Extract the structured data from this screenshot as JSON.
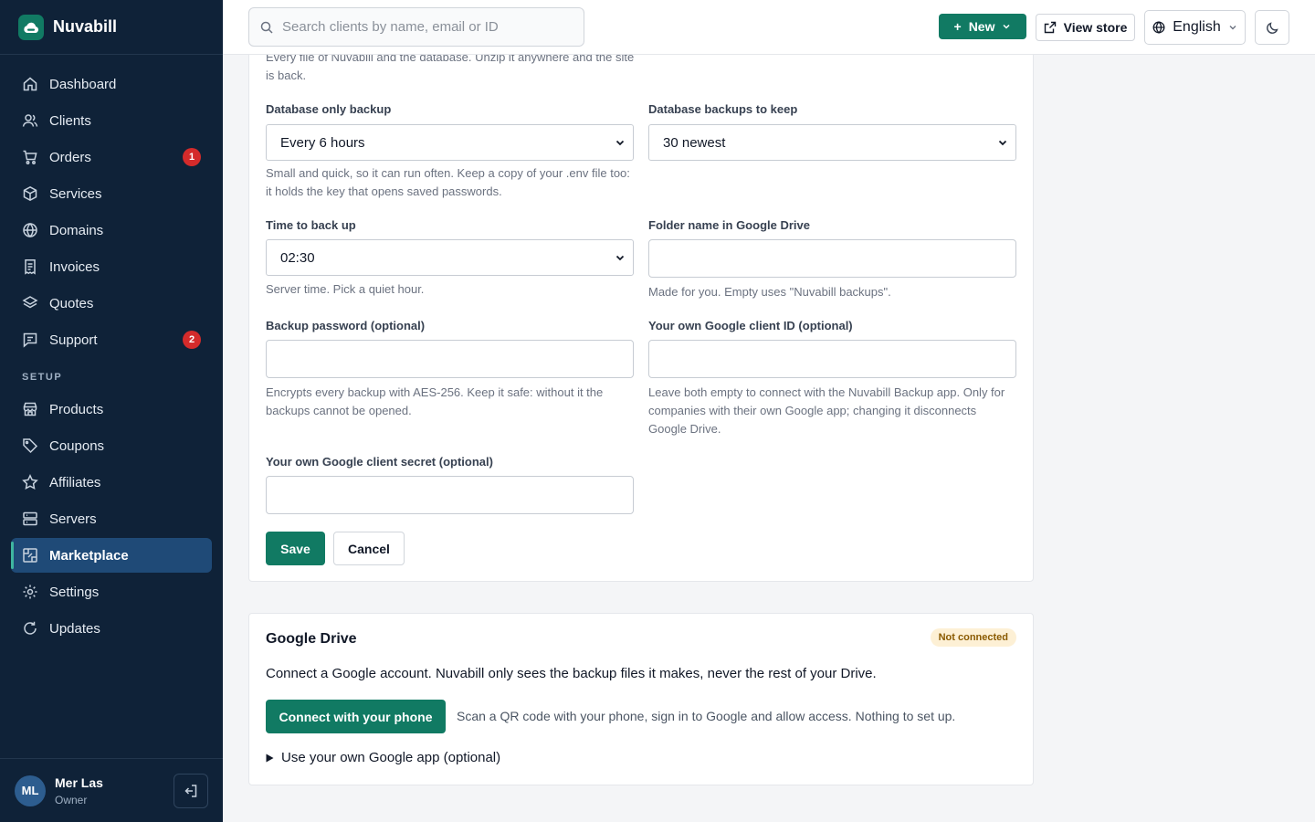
{
  "brand": {
    "name": "Nuvabill"
  },
  "sidebar": {
    "items": [
      {
        "label": "Dashboard",
        "icon": "home-icon"
      },
      {
        "label": "Clients",
        "icon": "users-icon"
      },
      {
        "label": "Orders",
        "icon": "cart-icon",
        "badge": "1"
      },
      {
        "label": "Services",
        "icon": "box-icon"
      },
      {
        "label": "Domains",
        "icon": "globe-icon"
      },
      {
        "label": "Invoices",
        "icon": "invoice-icon"
      },
      {
        "label": "Quotes",
        "icon": "layers-icon"
      },
      {
        "label": "Support",
        "icon": "chat-icon",
        "badge": "2"
      }
    ],
    "setup_label": "SETUP",
    "setup_items": [
      {
        "label": "Products",
        "icon": "store-icon"
      },
      {
        "label": "Coupons",
        "icon": "tag-icon"
      },
      {
        "label": "Affiliates",
        "icon": "star-icon"
      },
      {
        "label": "Servers",
        "icon": "server-icon"
      },
      {
        "label": "Marketplace",
        "icon": "marketplace-icon",
        "active": true
      },
      {
        "label": "Settings",
        "icon": "gear-icon"
      },
      {
        "label": "Updates",
        "icon": "refresh-icon"
      }
    ]
  },
  "user": {
    "initials": "ML",
    "name": "Mer Las",
    "role": "Owner"
  },
  "topbar": {
    "search_placeholder": "Search clients by name, email or ID",
    "new_label": "New",
    "view_store_label": "View store",
    "language_label": "English"
  },
  "backup_form": {
    "top_help": "Every file of Nuvabill and the database. Unzip it anywhere and the site is back.",
    "db_only_label": "Database only backup",
    "db_only_value": "Every 6 hours",
    "db_only_help": "Small and quick, so it can run often. Keep a copy of your .env file too: it holds the key that opens saved passwords.",
    "db_keep_label": "Database backups to keep",
    "db_keep_value": "30 newest",
    "time_label": "Time to back up",
    "time_value": "02:30",
    "time_help": "Server time. Pick a quiet hour.",
    "folder_label": "Folder name in Google Drive",
    "folder_value": "",
    "folder_help": "Made for you. Empty uses \"Nuvabill backups\".",
    "password_label": "Backup password (optional)",
    "password_value": "",
    "password_help": "Encrypts every backup with AES-256. Keep it safe: without it the backups cannot be opened.",
    "client_id_label": "Your own Google client ID (optional)",
    "client_id_value": "",
    "client_id_help": "Leave both empty to connect with the Nuvabill Backup app. Only for companies with their own Google app; changing it disconnects Google Drive.",
    "client_secret_label": "Your own Google client secret (optional)",
    "client_secret_value": "",
    "save_label": "Save",
    "cancel_label": "Cancel"
  },
  "google_drive": {
    "title": "Google Drive",
    "status": "Not connected",
    "description": "Connect a Google account. Nuvabill only sees the backup files it makes, never the rest of your Drive.",
    "connect_label": "Connect with your phone",
    "connect_help": "Scan a QR code with your phone, sign in to Google and allow access. Nothing to set up.",
    "own_app_label": "Use your own Google app (optional)"
  },
  "colors": {
    "sidebar_bg": "#0f2238",
    "accent": "#117a63",
    "active_nav": "#1f4a77",
    "badge": "#d42b2b",
    "status_pill_bg": "#fdf0d5"
  }
}
